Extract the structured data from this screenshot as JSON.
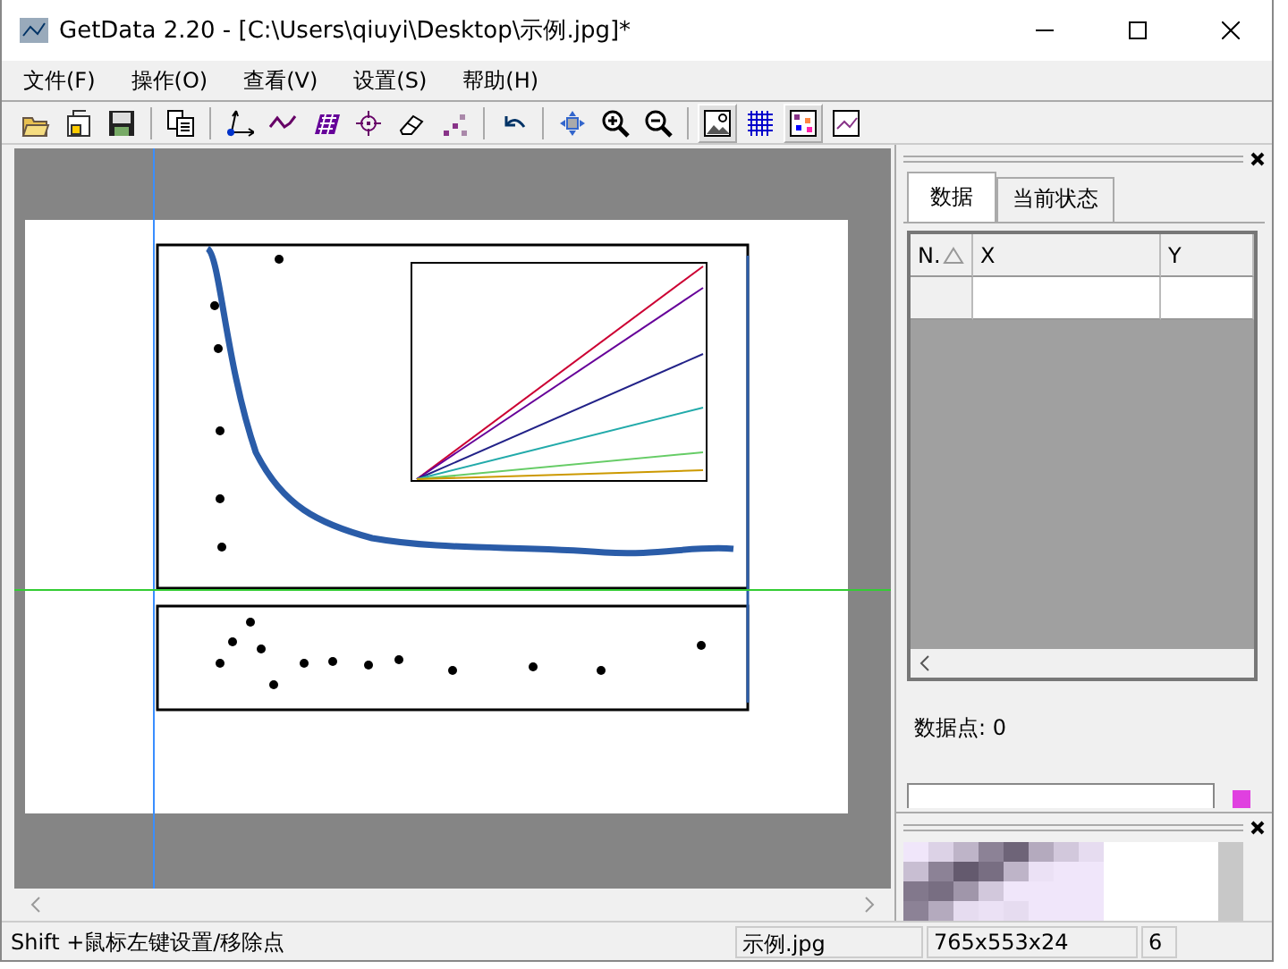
{
  "window": {
    "title": "GetData 2.20 - [C:\\Users\\qiuyi\\Desktop\\示例.jpg]*"
  },
  "menu": [
    "文件(F)",
    "操作(O)",
    "查看(V)",
    "设置(S)",
    "帮助(H)"
  ],
  "toolbar": [
    {
      "kind": "button",
      "pressed": false
    },
    {
      "kind": "button",
      "pressed": false
    },
    {
      "kind": "button",
      "pressed": false
    },
    {
      "kind": "separator"
    },
    {
      "kind": "button",
      "pressed": false
    },
    {
      "kind": "separator"
    },
    {
      "kind": "button",
      "pressed": false
    },
    {
      "kind": "button",
      "pressed": false
    },
    {
      "kind": "button",
      "pressed": false
    },
    {
      "kind": "button",
      "pressed": false
    },
    {
      "kind": "button",
      "pressed": false
    },
    {
      "kind": "button",
      "pressed": false
    },
    {
      "kind": "separator"
    },
    {
      "kind": "button",
      "pressed": false
    },
    {
      "kind": "separator"
    },
    {
      "kind": "button",
      "pressed": false
    },
    {
      "kind": "button",
      "pressed": false
    },
    {
      "kind": "button",
      "pressed": false
    },
    {
      "kind": "separator"
    },
    {
      "kind": "button",
      "pressed": true
    },
    {
      "kind": "button",
      "pressed": false
    },
    {
      "kind": "button",
      "pressed": true
    },
    {
      "kind": "button",
      "pressed": false
    }
  ],
  "side_panel": {
    "tabs": [
      {
        "label": "数据",
        "selected": true
      },
      {
        "label": "当前状态",
        "selected": false
      }
    ],
    "table": {
      "columns": [
        "N.",
        "X",
        "Y"
      ]
    },
    "point_count": "数据点: 0",
    "swatch": {
      "color": "#e040e0"
    }
  },
  "status_bar": [
    "Shift +鼠标左键设置/移除点",
    "示例.jpg",
    "765x553x24",
    "6"
  ]
}
